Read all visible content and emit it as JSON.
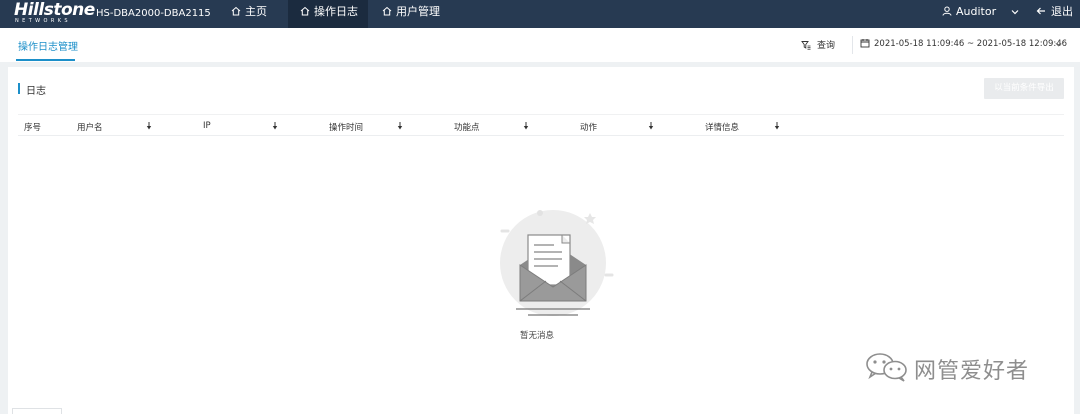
{
  "brand": {
    "name": "Hillstone",
    "tagline": "NETWORKS",
    "device": "HS-DBA2000-DBA2115"
  },
  "nav": {
    "items": [
      {
        "label": "主页",
        "icon": "home-icon",
        "active": false
      },
      {
        "label": "操作日志",
        "icon": "home-icon",
        "active": true
      },
      {
        "label": "用户管理",
        "icon": "home-icon",
        "active": false
      }
    ]
  },
  "user": {
    "name": "Auditor",
    "logout_label": "退出",
    "user_icon": "user-icon",
    "logout_icon": "arrow-left-icon"
  },
  "subheader": {
    "tab_label": "操作日志管理",
    "query_label": "查询",
    "query_icon": "filter-icon",
    "date_range": "2021-05-18 11:09:46 ~ 2021-05-18 12:09:46",
    "calendar_icon": "calendar-icon"
  },
  "panel": {
    "title": "日志",
    "export_label": "以当前条件导出"
  },
  "table": {
    "columns": [
      {
        "label": "序号",
        "sortable": false
      },
      {
        "label": "用户名",
        "sortable": true
      },
      {
        "label": "IP",
        "sortable": true
      },
      {
        "label": "操作时间",
        "sortable": true
      },
      {
        "label": "功能点",
        "sortable": true
      },
      {
        "label": "动作",
        "sortable": true
      },
      {
        "label": "详情信息",
        "sortable": true
      }
    ],
    "rows": [],
    "empty_text": "暂无消息"
  },
  "watermark": {
    "text": "网管爱好者",
    "icon": "wechat-icon"
  },
  "colors": {
    "topbar": "#273a52",
    "active_nav": "#1b2b3f",
    "accent": "#1c8fc9"
  }
}
